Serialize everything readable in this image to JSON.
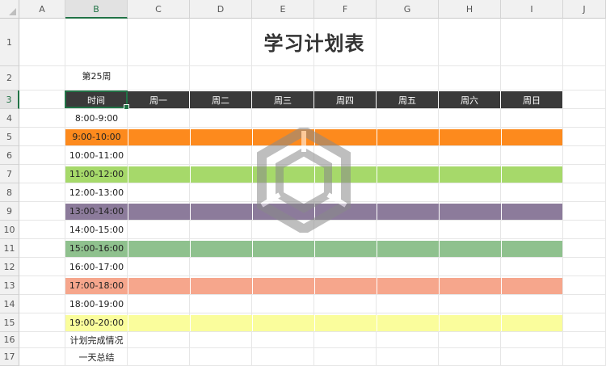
{
  "columns": [
    "A",
    "B",
    "C",
    "D",
    "E",
    "F",
    "G",
    "H",
    "I",
    "J"
  ],
  "selected_column": "B",
  "rows": [
    "1",
    "2",
    "3",
    "4",
    "5",
    "6",
    "7",
    "8",
    "9",
    "10",
    "11",
    "12",
    "13",
    "14",
    "15",
    "16",
    "17"
  ],
  "selected_row": "3",
  "title": "学习计划表",
  "week_label": "第25周",
  "table": {
    "header": [
      "时间",
      "周一",
      "周二",
      "周三",
      "周四",
      "周五",
      "周六",
      "周日"
    ],
    "slots": [
      {
        "label": "8:00-9:00",
        "color": "#ffffff"
      },
      {
        "label": "9:00-10:00",
        "color": "#fd8a1d"
      },
      {
        "label": "10:00-11:00",
        "color": "#ffffff"
      },
      {
        "label": "11:00-12:00",
        "color": "#a6d96a"
      },
      {
        "label": "12:00-13:00",
        "color": "#ffffff"
      },
      {
        "label": "13:00-14:00",
        "color": "#8c7b9b"
      },
      {
        "label": "14:00-15:00",
        "color": "#ffffff"
      },
      {
        "label": "15:00-16:00",
        "color": "#8fc18e"
      },
      {
        "label": "16:00-17:00",
        "color": "#ffffff"
      },
      {
        "label": "17:00-18:00",
        "color": "#f6a68c"
      },
      {
        "label": "18:00-19:00",
        "color": "#ffffff"
      },
      {
        "label": "19:00-20:00",
        "color": "#fafd9c"
      },
      {
        "label": "计划完成情况",
        "color": "#ffffff"
      },
      {
        "label": "一天总结",
        "color": "#ffffff"
      }
    ]
  },
  "colors": {
    "header_bg": "#3a3a3a",
    "selection": "#217346"
  },
  "icons": {
    "watermark": "hexagon-logo-icon"
  }
}
